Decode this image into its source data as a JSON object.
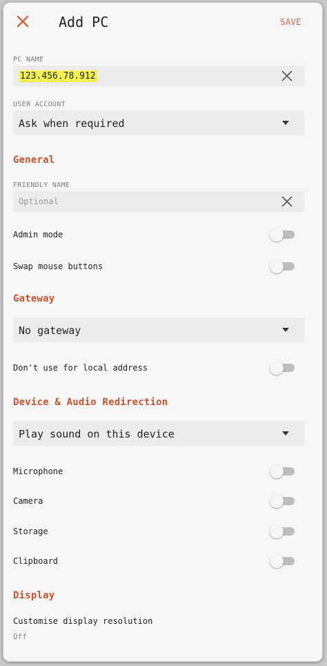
{
  "appbar": {
    "title": "Add PC",
    "save_label": "SAVE",
    "close_icon": "close-icon"
  },
  "pc_name": {
    "label": "PC NAME",
    "value": "123.456.78.912"
  },
  "user_account": {
    "label": "USER ACCOUNT",
    "value": "Ask when required"
  },
  "general": {
    "heading": "General",
    "friendly_name": {
      "label": "FRIENDLY NAME",
      "placeholder": "Optional"
    },
    "admin_mode": {
      "label": "Admin mode",
      "on": false
    },
    "swap_mouse": {
      "label": "Swap mouse buttons",
      "on": false
    }
  },
  "gateway": {
    "heading": "Gateway",
    "value": "No gateway",
    "local_address": {
      "label": "Don't use for local address",
      "on": false
    }
  },
  "redirection": {
    "heading": "Device & Audio Redirection",
    "sound": "Play sound on this device",
    "microphone": {
      "label": "Microphone",
      "on": false
    },
    "camera": {
      "label": "Camera",
      "on": false
    },
    "storage": {
      "label": "Storage",
      "on": false
    },
    "clipboard": {
      "label": "Clipboard",
      "on": false
    }
  },
  "display": {
    "heading": "Display",
    "custom_resolution": {
      "label": "Customise display resolution",
      "value": "Off"
    }
  },
  "colors": {
    "accent": "#d5613e",
    "section": "#c9532f",
    "highlight": "#f2f252",
    "field_bg": "#ececec"
  }
}
